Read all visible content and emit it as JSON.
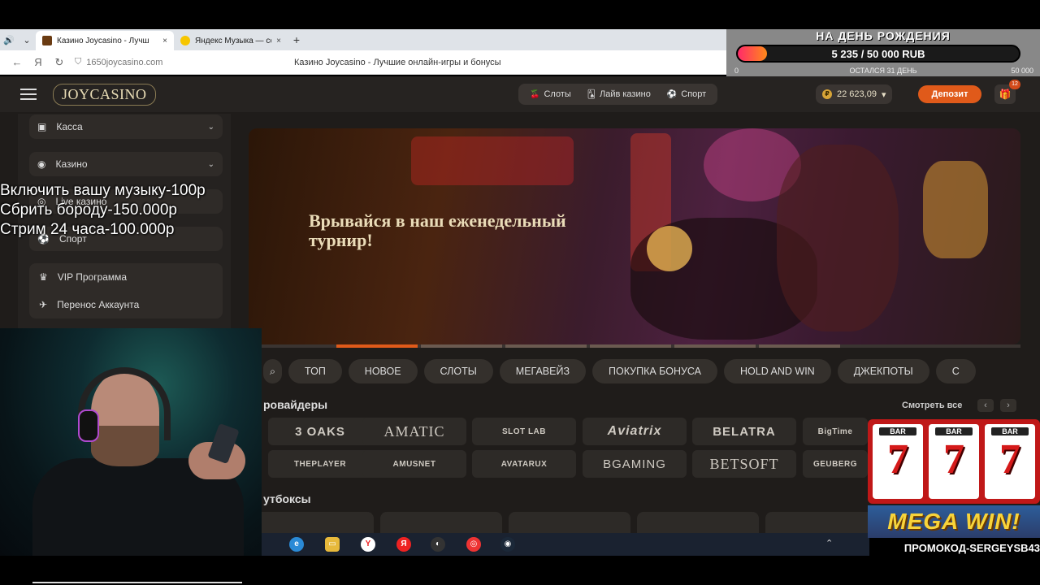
{
  "browser": {
    "tabs": [
      {
        "title": "Казино Joycasino - Лучш",
        "close": "×"
      },
      {
        "title": "Яндекс Музыка — со",
        "close": "×"
      }
    ],
    "new_tab": "+",
    "url": "1650joycasino.com",
    "page_title": "Казино Joycasino - Лучшие онлайн-игры и бонусы"
  },
  "site": {
    "logo": "JOYCASINO",
    "nav": [
      {
        "label": "Слоты",
        "icon": "cherry-icon"
      },
      {
        "label": "Лайв казино",
        "icon": "cards-icon"
      },
      {
        "label": "Спорт",
        "icon": "ball-icon"
      }
    ],
    "balance": "22 623,09",
    "deposit_label": "Депозит",
    "gift_badge": "12",
    "sidebar": {
      "kassa": "Касса",
      "casino": "Казино",
      "live": "Live казино",
      "sport": "Спорт",
      "vip": "VIP Программа",
      "transfer": "Перенос Аккаунта"
    },
    "banner_title": "Врывайся в наш еженедельный турнир!",
    "categories": [
      "ТОП",
      "НОВОЕ",
      "СЛОТЫ",
      "МЕГАВЕЙЗ",
      "ПОКУПКА БОНУСА",
      "HOLD AND WIN",
      "ДЖЕКПОТЫ"
    ],
    "providers_title": "ровайдеры",
    "see_all": "Смотреть все",
    "providers_row1": [
      "3 OAKS",
      "AMATIC",
      "SLOT LAB",
      "Aviatrix",
      "BELATRA",
      "BigTime"
    ],
    "providers_row2": [
      "THEPLAYER",
      "AMUSNET",
      "AVATARUX",
      "BGAMING",
      "BETSOFT",
      "GEUBERG"
    ],
    "lootboxes_title": "утбоксы"
  },
  "overlay": {
    "donation_title": "НА ДЕНЬ РОЖДЕНИЯ",
    "donation_amount": "5 235 / 50 000 RUB",
    "donation_progress": 0.105,
    "donation_min": "0",
    "donation_remaining": "ОСТАЛСЯ 31 ДЕНЬ",
    "donation_max": "50 000",
    "stream_lines": [
      "Включить вашу музыку-100р",
      "Сбрить бороду-150.000р",
      "Стрим 24 часа-100.000р"
    ],
    "mega_win": "MEGA WIN!",
    "promo": "ПРОМОКОД-SERGEYSB43",
    "slot_symbol": "7",
    "slot_bar": "BAR"
  },
  "colors": {
    "accent": "#e05a1a",
    "panel": "#2f2b28",
    "background": "#1f1c1a"
  }
}
